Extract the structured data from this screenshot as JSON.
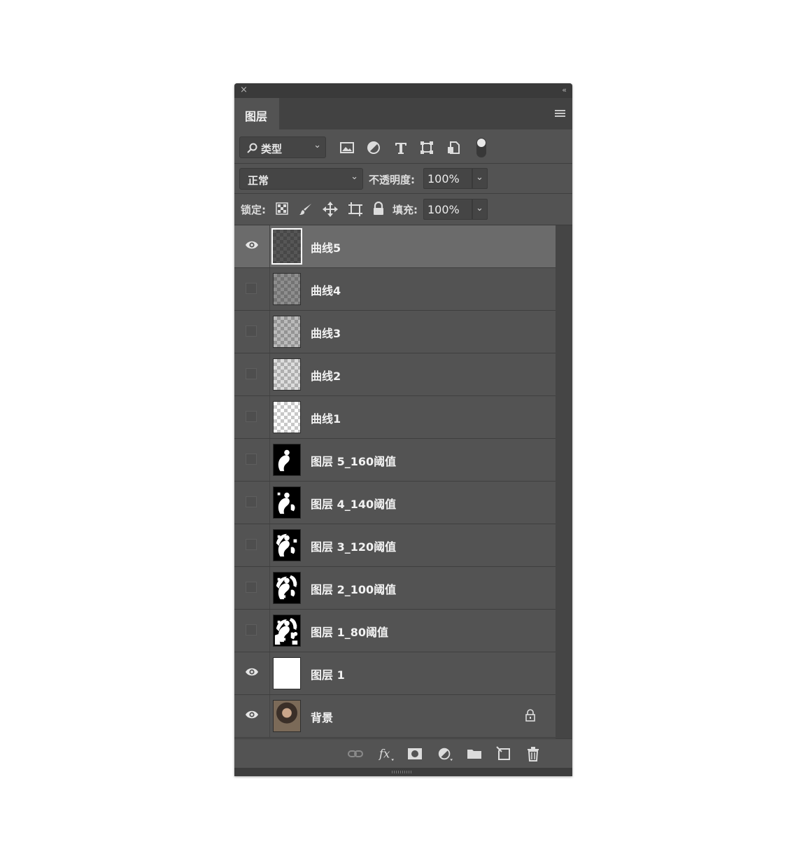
{
  "panel": {
    "close_glyph": "×",
    "collapse_glyph": "‹‹",
    "tab_label": "图层"
  },
  "filter": {
    "kind_label": "类型",
    "icons": [
      "image-filter-icon",
      "adjustment-filter-icon",
      "type-filter-icon",
      "shape-filter-icon",
      "smart-object-filter-icon",
      "filter-toggle"
    ]
  },
  "blend": {
    "mode": "正常",
    "opacity_label": "不透明度:",
    "opacity_value": "100%"
  },
  "lock": {
    "label": "锁定:",
    "fill_label": "填充:",
    "fill_value": "100%"
  },
  "layers": [
    {
      "name": "曲线5",
      "visible": true,
      "selected": true,
      "thumb": "checker-dark"
    },
    {
      "name": "曲线4",
      "visible": false,
      "thumb": "checker-mid-dark"
    },
    {
      "name": "曲线3",
      "visible": false,
      "thumb": "checker-mid"
    },
    {
      "name": "曲线2",
      "visible": false,
      "thumb": "checker-light"
    },
    {
      "name": "曲线1",
      "visible": false,
      "thumb": "checker"
    },
    {
      "name": "图层 5_160阈值",
      "visible": false,
      "thumb": "threshold-160"
    },
    {
      "name": "图层 4_140阈值",
      "visible": false,
      "thumb": "threshold-140"
    },
    {
      "name": "图层 3_120阈值",
      "visible": false,
      "thumb": "threshold-120"
    },
    {
      "name": "图层 2_100阈值",
      "visible": false,
      "thumb": "threshold-100"
    },
    {
      "name": "图层 1_80阈值",
      "visible": false,
      "thumb": "threshold-80"
    },
    {
      "name": "图层 1",
      "visible": true,
      "thumb": "white"
    },
    {
      "name": "背景",
      "visible": true,
      "locked": true,
      "thumb": "photo"
    }
  ],
  "bottom_icons": [
    "link-layers-icon",
    "fx-icon",
    "add-mask-icon",
    "adjustment-layer-icon",
    "new-group-icon",
    "new-layer-icon",
    "delete-layer-icon"
  ],
  "colors": {
    "panel_bg": "#535353",
    "selected_row": "#6b6b6b",
    "title_bar": "#3a3a3a"
  }
}
